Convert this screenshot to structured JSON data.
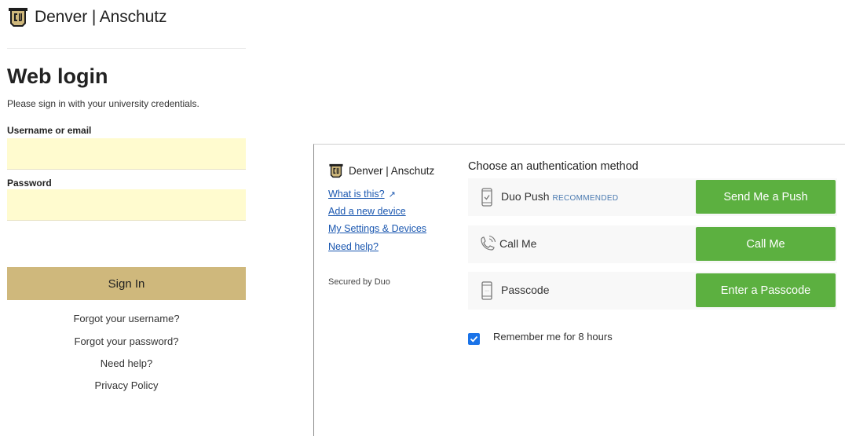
{
  "login": {
    "brand": "Denver | Anschutz",
    "title": "Web login",
    "subtitle": "Please sign in with your university credentials.",
    "username_label": "Username or email",
    "username_value": "",
    "password_label": "Password",
    "password_value": "",
    "sign_in_label": "Sign In",
    "links": [
      "Forgot your username?",
      "Forgot your password?",
      "Need help?",
      "Privacy Policy"
    ]
  },
  "duo": {
    "brand": "Denver | Anschutz",
    "side_links": [
      "What is this?",
      "Add a new device",
      "My Settings & Devices",
      "Need help?"
    ],
    "secured_by": "Secured by Duo",
    "heading": "Choose an authentication method",
    "methods": [
      {
        "label": "Duo Push",
        "badge": "RECOMMENDED",
        "button": "Send Me a Push",
        "icon": "phone-icon"
      },
      {
        "label": "Call Me",
        "badge": "",
        "button": "Call Me",
        "icon": "phone-call-icon"
      },
      {
        "label": "Passcode",
        "badge": "",
        "button": "Enter a Passcode",
        "icon": "passcode-icon"
      }
    ],
    "remember_label": "Remember me for 8 hours",
    "remember_checked": true
  },
  "colors": {
    "gold": "#cfb87c",
    "input_bg": "#fffbcf",
    "duo_green": "#5cb040",
    "link_blue": "#1a57b0",
    "checkbox_blue": "#1a73e8"
  }
}
